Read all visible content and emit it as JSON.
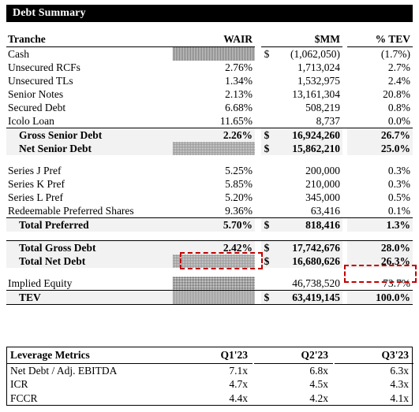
{
  "title": "Debt Summary",
  "debt_table": {
    "columns": [
      "Tranche",
      "WAIR",
      "$MM",
      "% TEV"
    ],
    "rows": [
      {
        "label": "Cash",
        "wair": "",
        "cur": "$",
        "mm": "(1,062,050)",
        "tev": "(1.7%)",
        "wair_hatched": true,
        "bold": false,
        "shaded": false,
        "indent": false
      },
      {
        "label": "Unsecured RCFs",
        "wair": "2.76%",
        "cur": "",
        "mm": "1,713,024",
        "tev": "2.7%",
        "wair_hatched": false,
        "bold": false,
        "shaded": false,
        "indent": false
      },
      {
        "label": "Unsecured TLs",
        "wair": "1.34%",
        "cur": "",
        "mm": "1,532,975",
        "tev": "2.4%",
        "wair_hatched": false,
        "bold": false,
        "shaded": false,
        "indent": false
      },
      {
        "label": "Senior Notes",
        "wair": "2.13%",
        "cur": "",
        "mm": "13,161,304",
        "tev": "20.8%",
        "wair_hatched": false,
        "bold": false,
        "shaded": false,
        "indent": false
      },
      {
        "label": "Secured Debt",
        "wair": "6.68%",
        "cur": "",
        "mm": "508,219",
        "tev": "0.8%",
        "wair_hatched": false,
        "bold": false,
        "shaded": false,
        "indent": false
      },
      {
        "label": "Icolo Loan",
        "wair": "11.65%",
        "cur": "",
        "mm": "8,737",
        "tev": "0.0%",
        "wair_hatched": false,
        "bold": false,
        "shaded": false,
        "indent": false
      },
      {
        "label": "Gross Senior Debt",
        "wair": "2.26%",
        "cur": "$",
        "mm": "16,924,260",
        "tev": "26.7%",
        "wair_hatched": false,
        "bold": true,
        "shaded": true,
        "indent": true
      },
      {
        "label": "Net Senior Debt",
        "wair": "",
        "cur": "$",
        "mm": "15,862,210",
        "tev": "25.0%",
        "wair_hatched": true,
        "bold": true,
        "shaded": true,
        "indent": true
      },
      {
        "label": "Series J Pref",
        "wair": "5.25%",
        "cur": "",
        "mm": "200,000",
        "tev": "0.3%",
        "wair_hatched": false,
        "bold": false,
        "shaded": false,
        "indent": false
      },
      {
        "label": "Series K Pref",
        "wair": "5.85%",
        "cur": "",
        "mm": "210,000",
        "tev": "0.3%",
        "wair_hatched": false,
        "bold": false,
        "shaded": false,
        "indent": false
      },
      {
        "label": "Series L Pref",
        "wair": "5.20%",
        "cur": "",
        "mm": "345,000",
        "tev": "0.5%",
        "wair_hatched": false,
        "bold": false,
        "shaded": false,
        "indent": false
      },
      {
        "label": "Redeemable Preferred Shares",
        "wair": "9.36%",
        "cur": "",
        "mm": "63,416",
        "tev": "0.1%",
        "wair_hatched": false,
        "bold": false,
        "shaded": false,
        "indent": false
      },
      {
        "label": "Total Preferred",
        "wair": "5.70%",
        "cur": "$",
        "mm": "818,416",
        "tev": "1.3%",
        "wair_hatched": false,
        "bold": true,
        "shaded": true,
        "indent": true
      },
      {
        "label": "Total Gross Debt",
        "wair": "2.42%",
        "cur": "$",
        "mm": "17,742,676",
        "tev": "28.0%",
        "wair_hatched": false,
        "bold": true,
        "shaded": true,
        "indent": true
      },
      {
        "label": "Total Net Debt",
        "wair": "",
        "cur": "$",
        "mm": "16,680,626",
        "tev": "26.3%",
        "wair_hatched": true,
        "bold": true,
        "shaded": true,
        "indent": true
      },
      {
        "label": "Implied Equity",
        "wair": "",
        "cur": "",
        "mm": "46,738,520",
        "tev": "73.7%",
        "wair_hatched": true,
        "bold": false,
        "shaded": false,
        "indent": false
      },
      {
        "label": "TEV",
        "wair": "",
        "cur": "$",
        "mm": "63,419,145",
        "tev": "100.0%",
        "wair_hatched": true,
        "bold": true,
        "shaded": true,
        "indent": true
      }
    ]
  },
  "leverage_table": {
    "columns": [
      "Leverage Metrics",
      "Q1'23",
      "Q2'23",
      "Q3'23"
    ],
    "rows": [
      {
        "label": "Net Debt / Adj. EBITDA",
        "q1": "7.1x",
        "q2": "6.8x",
        "q3": "6.3x"
      },
      {
        "label": "ICR",
        "q1": "4.7x",
        "q2": "4.5x",
        "q3": "4.3x"
      },
      {
        "label": "FCCR",
        "q1": "4.4x",
        "q2": "4.2x",
        "q3": "4.1x"
      }
    ]
  },
  "annotations": {
    "color": "#c00000",
    "boxes": [
      {
        "name": "total-gross-debt-wair",
        "value": "2.42%"
      },
      {
        "name": "total-net-debt-tev",
        "value": "26.3%"
      }
    ]
  }
}
